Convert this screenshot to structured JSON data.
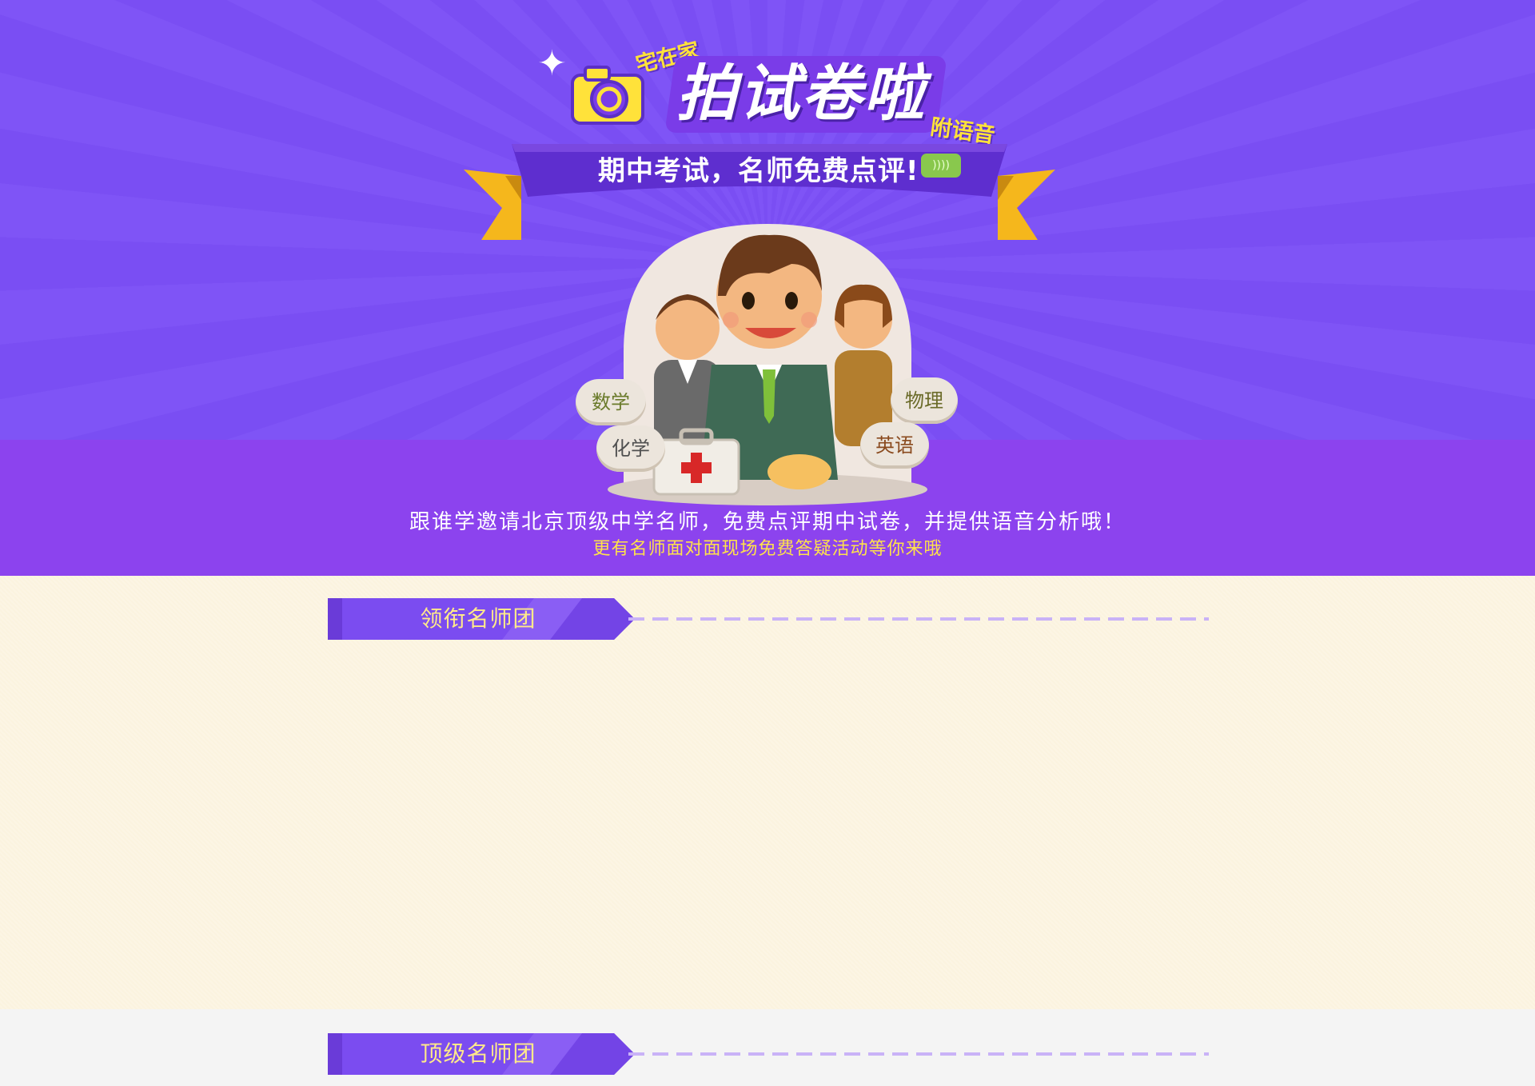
{
  "hero": {
    "tag_home": "宅在家",
    "main_title": "拍试卷啦",
    "tag_voice": "附语音",
    "ribbon_text": "期中考试，名师免费点评!",
    "subjects": {
      "math": "数学",
      "physics": "物理",
      "chemistry": "化学",
      "english": "英语"
    },
    "line1": "跟谁学邀请北京顶级中学名师，免费点评期中试卷，并提供语音分析哦！",
    "line2": "更有名师面对面现场免费答疑活动等你来哦"
  },
  "sections": [
    {
      "label": "领衔名师团"
    },
    {
      "label": "顶级名师团"
    }
  ],
  "colors": {
    "hero_purple": "#7f54f6",
    "band_purple": "#8c43ee",
    "tab_purple": "#7b4cf0",
    "tab_text_yellow": "#ffe98a",
    "cream_bg": "#fbf3df",
    "accent_yellow": "#ffe23a"
  },
  "icons": [
    "sparkle-icon",
    "camera-icon",
    "voice-icon",
    "first-aid-kit-icon"
  ]
}
